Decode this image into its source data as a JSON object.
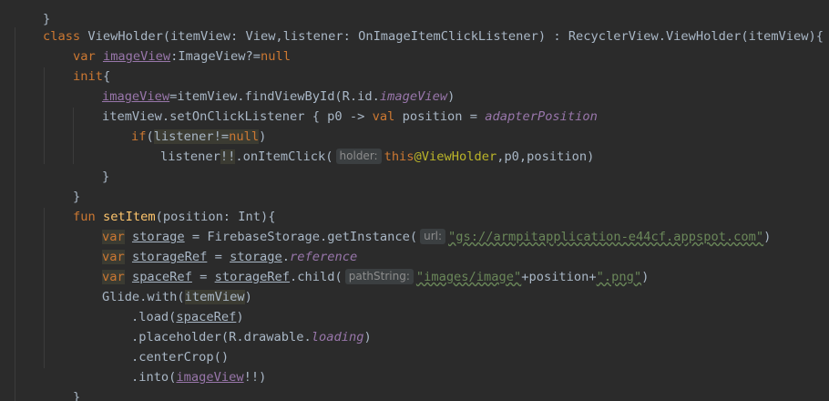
{
  "code": {
    "prev_brace": "}",
    "l1": {
      "kw_class": "class",
      "cls": "ViewHolder",
      "p1": "(itemView: View,listener: OnImageItemClickListener) : RecyclerView.ViewHolder(itemView){"
    },
    "l2": {
      "kw": "var",
      "name": "imageView",
      "rest": ":ImageView?=",
      "null": "null"
    },
    "l3": {
      "init": "init",
      "brace": "{"
    },
    "l4": {
      "name": "imageView",
      "rest": "=itemView.findViewById(R.id.",
      "id": "imageView",
      "close": ")"
    },
    "l5": {
      "pre": "itemView.setOnClickListener { p0 -> ",
      "kw": "val",
      "mid": " position = ",
      "prop": "adapterPosition"
    },
    "l6": {
      "kw_if": "if",
      "open": "(",
      "cond": "listener!=",
      "null": "null",
      "close": ")"
    },
    "l7": {
      "pre": "listener",
      "bang": "!!",
      "call": ".onItemClick(",
      "hint": "holder:",
      "this": "this",
      "at": "@ViewHolder",
      "args": ",p0,position)"
    },
    "l8": {
      "brace": "}"
    },
    "l9": {
      "brace": "}"
    },
    "l10": {
      "kw": "fun",
      "name": "setItem",
      "rest": "(position: Int){"
    },
    "l11": {
      "kw": "var",
      "name": "storage",
      "rest": " = FirebaseStorage.getInstance(",
      "hint": "url:",
      "str": "\"gs://armpitapplication-e44cf.appspot.com\"",
      "close": ")"
    },
    "l12": {
      "kw": "var",
      "name": "storageRef",
      "mid": " = ",
      "ref": "storage",
      "dot": ".",
      "prop": "reference"
    },
    "l13": {
      "kw": "var",
      "name": "spaceRef",
      "mid": " = ",
      "ref": "storageRef",
      "call": ".child(",
      "hint": "pathString:",
      "str1": "\"images/image\"",
      "plus": "+position+",
      "str2": "\".png\"",
      "close": ")"
    },
    "l14": {
      "pre": "Glide.with(",
      "arg": "itemView",
      "close": ")"
    },
    "l15": {
      "pre": ".load(",
      "arg": "spaceRef",
      "close": ")"
    },
    "l16": {
      "pre": ".placeholder(R.drawable.",
      "prop": "loading",
      "close": ")"
    },
    "l17": {
      "text": ".centerCrop()"
    },
    "l18": {
      "pre": ".into(",
      "arg": "imageView",
      "bang": "!!",
      "close": ")"
    },
    "l19": {
      "brace": "}"
    }
  },
  "colors": {
    "background": "#2b2b2b",
    "keyword": "#cc7832",
    "function": "#ffc66d",
    "string": "#6a8759",
    "property": "#9876aa",
    "default": "#a9b7c6"
  }
}
